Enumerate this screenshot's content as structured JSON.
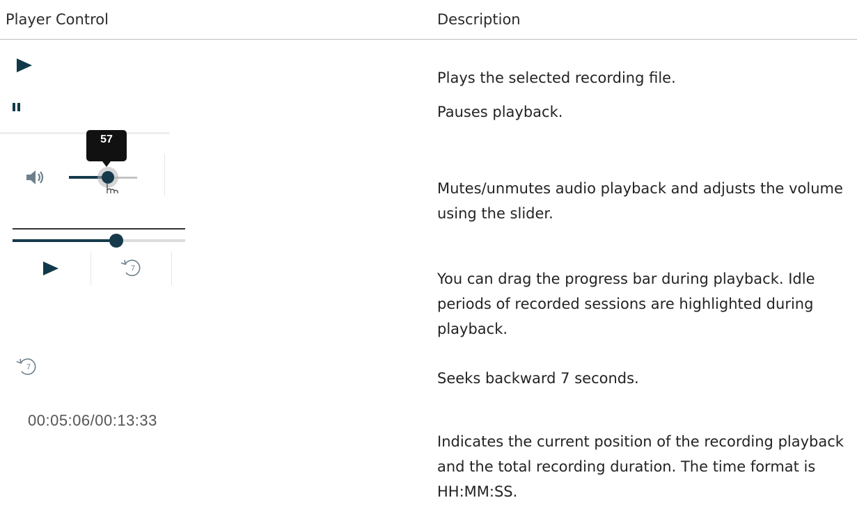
{
  "header": {
    "col_control": "Player Control",
    "col_description": "Description"
  },
  "rows": [
    {
      "control": "play-icon",
      "description": "Plays the selected recording file."
    },
    {
      "control": "pause-icon",
      "description": "Pauses playback."
    },
    {
      "control": "volume-control",
      "description": "Mutes/unmutes audio playback and adjusts the volume using the slider."
    },
    {
      "control": "progress-bar",
      "description": "You can drag the progress bar during playback. Idle periods of recorded sessions are highlighted during playback."
    },
    {
      "control": "seek-back-7-icon",
      "description": "Seeks backward 7 seconds."
    },
    {
      "control": "time-display",
      "description": "Indicates the current position of the recording playback and the total recording duration.  The time format is HH:MM:SS."
    }
  ],
  "volume": {
    "tooltip_value": "57",
    "level_percent": 57
  },
  "progress": {
    "level_percent": 60
  },
  "seek": {
    "seconds_label": "7"
  },
  "time": {
    "display": "00:05:06/00:13:33"
  },
  "colors": {
    "icon_dark": "#12394a",
    "text": "#232323",
    "rule": "#bdbdbd"
  }
}
